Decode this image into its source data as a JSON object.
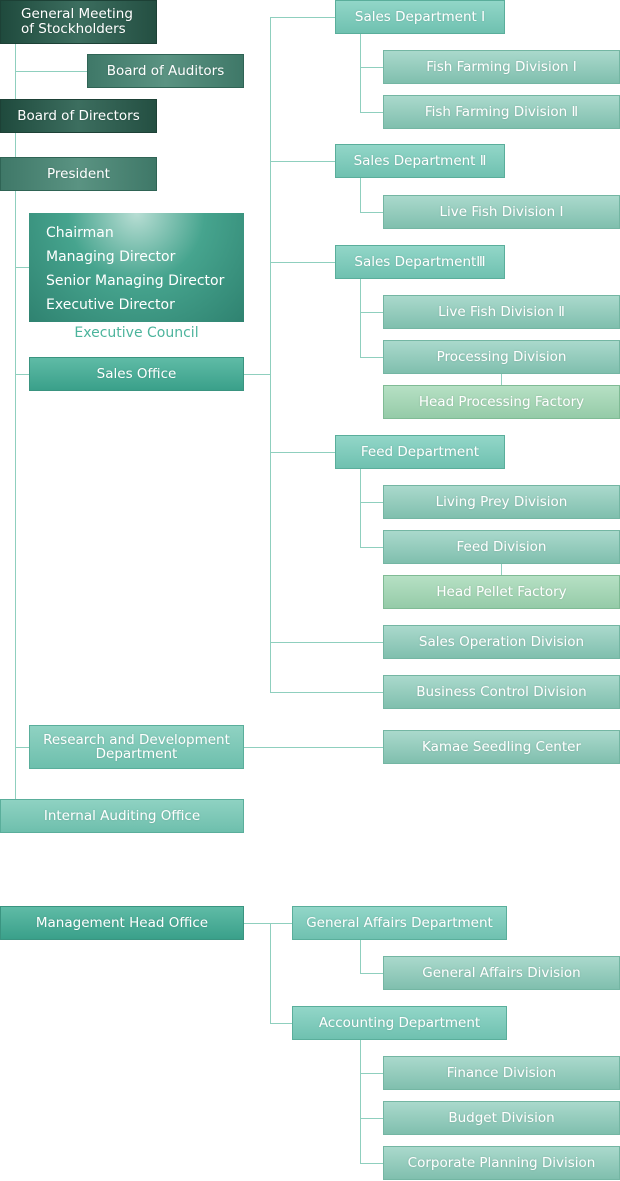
{
  "top": {
    "general_meeting": "General Meeting of Stockholders",
    "board_of_auditors": "Board of Auditors",
    "board_of_directors": "Board of Directors",
    "president": "President",
    "executive_council": {
      "members": [
        "Chairman",
        "Managing Director",
        "Senior Managing Director",
        "Executive Director"
      ],
      "label": "Executive Council"
    },
    "sales_office": "Sales Office",
    "rnd": "Research and Development Department",
    "internal_auditing": "Internal Auditing Office",
    "management_head_office": "Management Head Office"
  },
  "sales": {
    "sales1": "Sales Department Ⅰ",
    "ff1": "Fish Farming Division Ⅰ",
    "ff2": "Fish Farming Division Ⅱ",
    "sales2": "Sales Department Ⅱ",
    "lf1": "Live Fish Division Ⅰ",
    "sales3": "Sales DepartmentⅢ",
    "lf2": "Live Fish Division Ⅱ",
    "processing": "Processing Division",
    "head_processing": "Head Processing Factory",
    "feed_dept": "Feed Department",
    "living_prey": "Living Prey Division",
    "feed_div": "Feed Division",
    "head_pellet": "Head Pellet Factory",
    "sales_operation": "Sales Operation Division",
    "business_control": "Business Control Division",
    "kamae": "Kamae Seedling Center"
  },
  "management": {
    "general_affairs_dept": "General Affairs Department",
    "general_affairs_div": "General Affairs Division",
    "accounting_dept": "Accounting Department",
    "finance": "Finance Division",
    "budget": "Budget Division",
    "corporate_planning": "Corporate Planning Division"
  }
}
